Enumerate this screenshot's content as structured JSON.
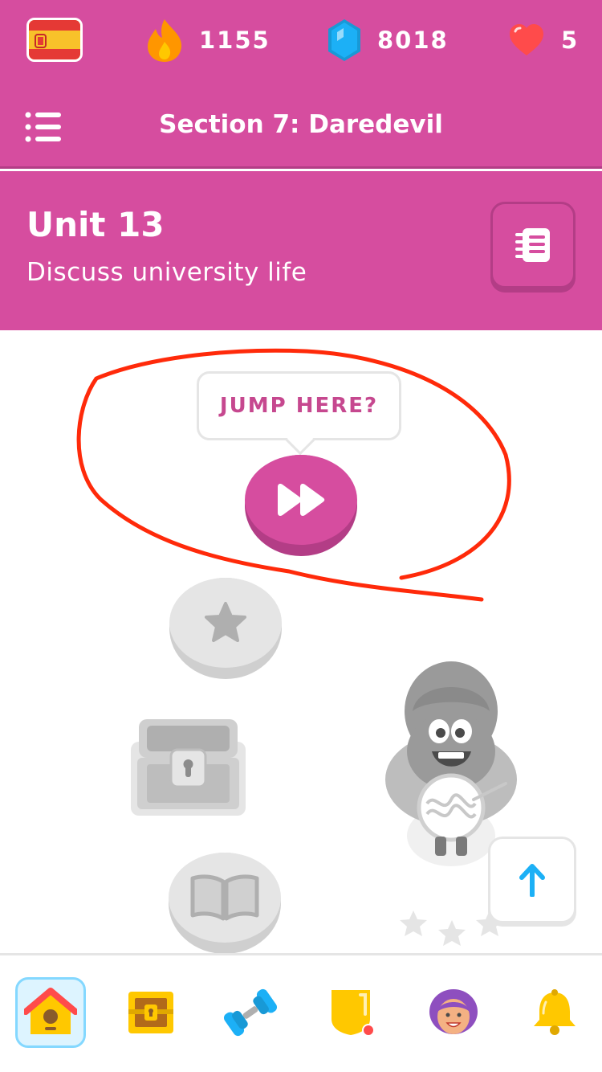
{
  "top_bar": {
    "course_flag": "spain-flag-icon",
    "streak": {
      "icon": "flame-icon",
      "value": "1155",
      "color": "#ff9600"
    },
    "gems": {
      "icon": "gem-icon",
      "value": "8018",
      "color": "#1cb0f6"
    },
    "hearts": {
      "icon": "heart-icon",
      "value": "5",
      "color": "#ff4b4b"
    }
  },
  "section_bar": {
    "menu_icon": "list-menu-icon",
    "title": "Section 7: Daredevil"
  },
  "unit": {
    "title": "Unit 13",
    "subtitle": "Discuss university life",
    "guidebook_icon": "guidebook-icon"
  },
  "path": {
    "jump_tooltip": "JUMP HERE?",
    "nodes": [
      {
        "type": "jump",
        "icon": "fast-forward-icon",
        "state": "active"
      },
      {
        "type": "lesson",
        "icon": "star-icon",
        "state": "locked"
      },
      {
        "type": "chest",
        "icon": "treasure-chest-icon",
        "state": "locked"
      },
      {
        "type": "story",
        "icon": "book-icon",
        "state": "locked"
      }
    ],
    "character_icon": "character-with-noodle-bowl-icon",
    "scroll_up_icon": "arrow-up-icon"
  },
  "bottom_nav": [
    {
      "name": "learn",
      "icon": "home-icon",
      "active": true
    },
    {
      "name": "chest",
      "icon": "treasure-chest-icon",
      "active": false
    },
    {
      "name": "practice",
      "icon": "dumbbell-icon",
      "active": false
    },
    {
      "name": "leaderboards",
      "icon": "league-shield-icon",
      "active": false,
      "badge": true
    },
    {
      "name": "profile",
      "icon": "profile-avatar-icon",
      "active": false
    },
    {
      "name": "notifications",
      "icon": "bell-icon",
      "active": false
    }
  ],
  "colors": {
    "brand_pink": "#d64d9f",
    "brand_pink_dark": "#b33d86",
    "tooltip_text": "#c6488f",
    "annotation_red": "#ff2a0a",
    "locked_gray": "#e5e5e5",
    "nav_active_bg": "#ddf4ff"
  }
}
